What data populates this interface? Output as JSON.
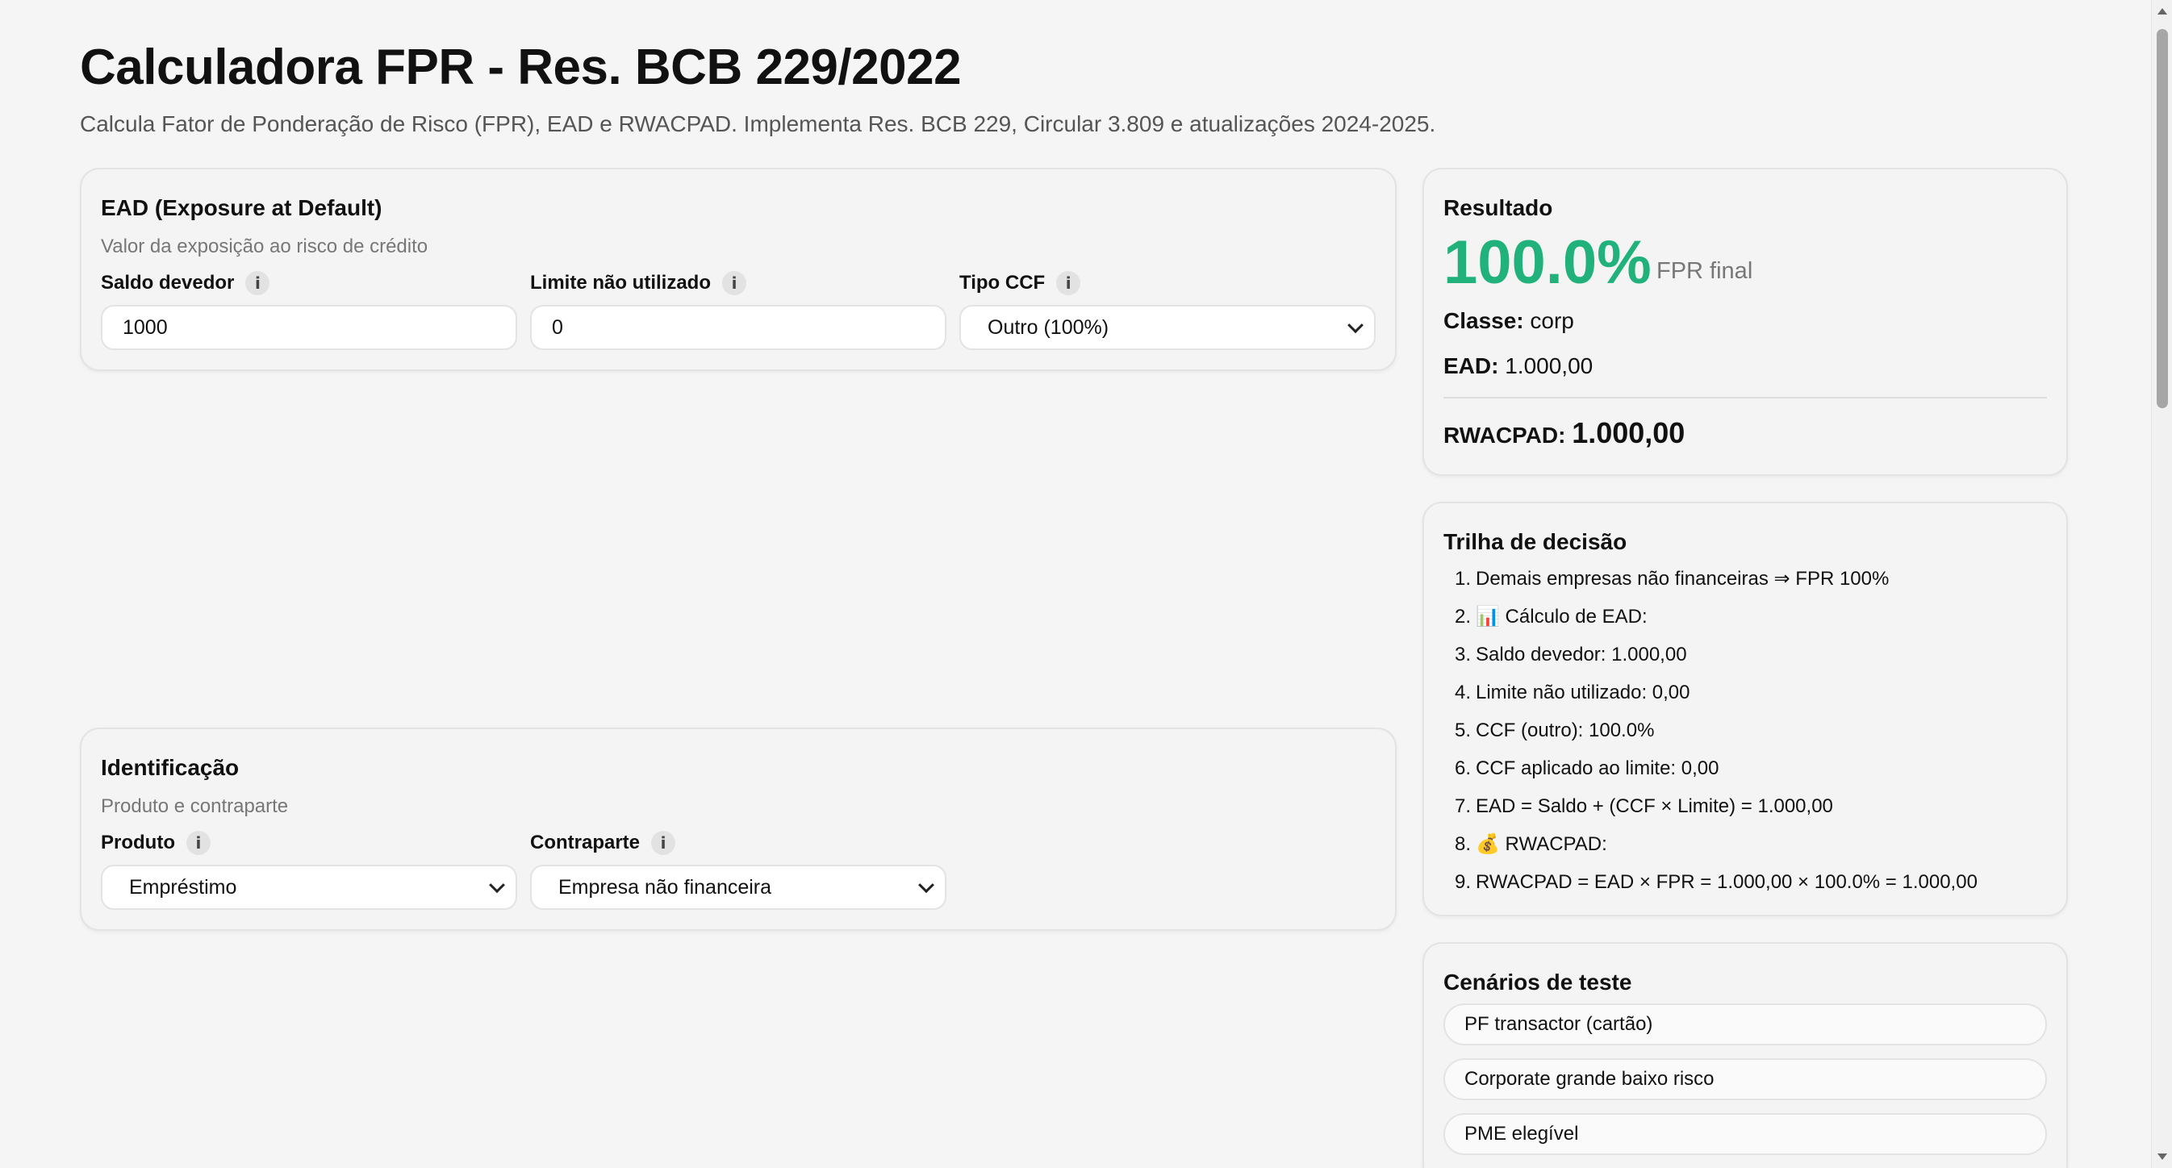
{
  "page": {
    "title": "Calculadora FPR - Res. BCB 229/2022",
    "subtitle": "Calcula Fator de Ponderação de Risco (FPR), EAD e RWACPAD. Implementa Res. BCB 229, Circular 3.809 e atualizações 2024-2025."
  },
  "ead": {
    "title": "EAD (Exposure at Default)",
    "description": "Valor da exposição ao risco de crédito",
    "saldo_label": "Saldo devedor",
    "saldo_value": "1000",
    "limite_label": "Limite não utilizado",
    "limite_value": "0",
    "ccf_label": "Tipo CCF",
    "ccf_value": "Outro (100%)"
  },
  "identificacao": {
    "title": "Identificação",
    "description": "Produto e contraparte",
    "produto_label": "Produto",
    "produto_value": "Empréstimo",
    "contraparte_label": "Contraparte",
    "contraparte_value": "Empresa não financeira"
  },
  "resultado": {
    "title": "Resultado",
    "fpr_value": "100.0%",
    "fpr_caption": "FPR final",
    "classe_label": "Classe:",
    "classe_value": "corp",
    "ead_label": "EAD:",
    "ead_value": "1.000,00",
    "rwacpad_label": "RWACPAD:",
    "rwacpad_value": "1.000,00"
  },
  "trilha": {
    "title": "Trilha de decisão",
    "items": [
      {
        "num": "1.",
        "text": "Demais empresas não financeiras ⇒ FPR 100%"
      },
      {
        "num": "2.",
        "text": "📊 Cálculo de EAD:"
      },
      {
        "num": "3.",
        "text": "Saldo devedor: 1.000,00"
      },
      {
        "num": "4.",
        "text": "Limite não utilizado: 0,00"
      },
      {
        "num": "5.",
        "text": "CCF (outro): 100.0%"
      },
      {
        "num": "6.",
        "text": "CCF aplicado ao limite: 0,00"
      },
      {
        "num": "7.",
        "text": "EAD = Saldo + (CCF × Limite) = 1.000,00"
      },
      {
        "num": "8.",
        "text": "💰 RWACPAD:"
      },
      {
        "num": "9.",
        "text": "RWACPAD = EAD × FPR = 1.000,00 × 100.0% = 1.000,00"
      }
    ]
  },
  "cenarios": {
    "title": "Cenários de teste",
    "items": [
      "PF transactor (cartão)",
      "Corporate grande baixo risco",
      "PME elegível"
    ]
  },
  "info_glyph": "i",
  "colors": {
    "accent_green": "#20b27a",
    "background": "#f5f5f5",
    "card_border": "#e3e3e3"
  }
}
